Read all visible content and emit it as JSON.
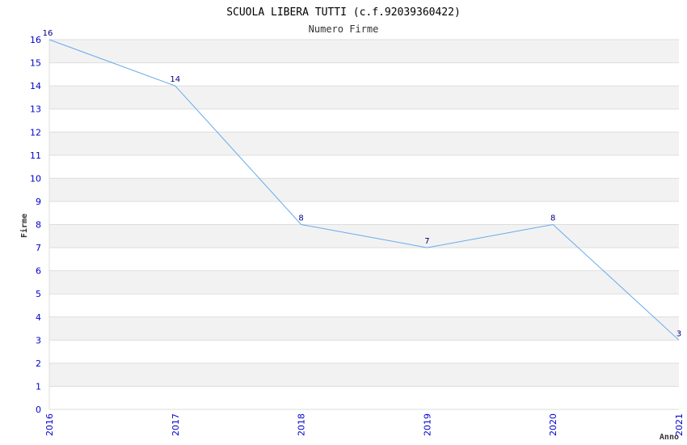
{
  "chart_data": {
    "type": "line",
    "title": "SCUOLA LIBERA TUTTI (c.f.92039360422)",
    "subtitle": "Numero Firme",
    "xlabel": "Anno",
    "ylabel": "Firme",
    "categories": [
      "2016",
      "2017",
      "2018",
      "2019",
      "2020",
      "2021"
    ],
    "values": [
      16,
      14,
      8,
      7,
      8,
      3
    ],
    "ylim": [
      0,
      16
    ],
    "yticks": [
      "0",
      "1",
      "2",
      "3",
      "4",
      "5",
      "6",
      "7",
      "8",
      "9",
      "10",
      "11",
      "12",
      "13",
      "14",
      "15",
      "16"
    ],
    "grid": true,
    "colors": {
      "line": "#66aaee",
      "band_alt": "#f2f2f2",
      "band": "#ffffff",
      "gridline": "#dddddd",
      "tick_text": "#0000cc",
      "data_label_text": "#000080"
    }
  }
}
